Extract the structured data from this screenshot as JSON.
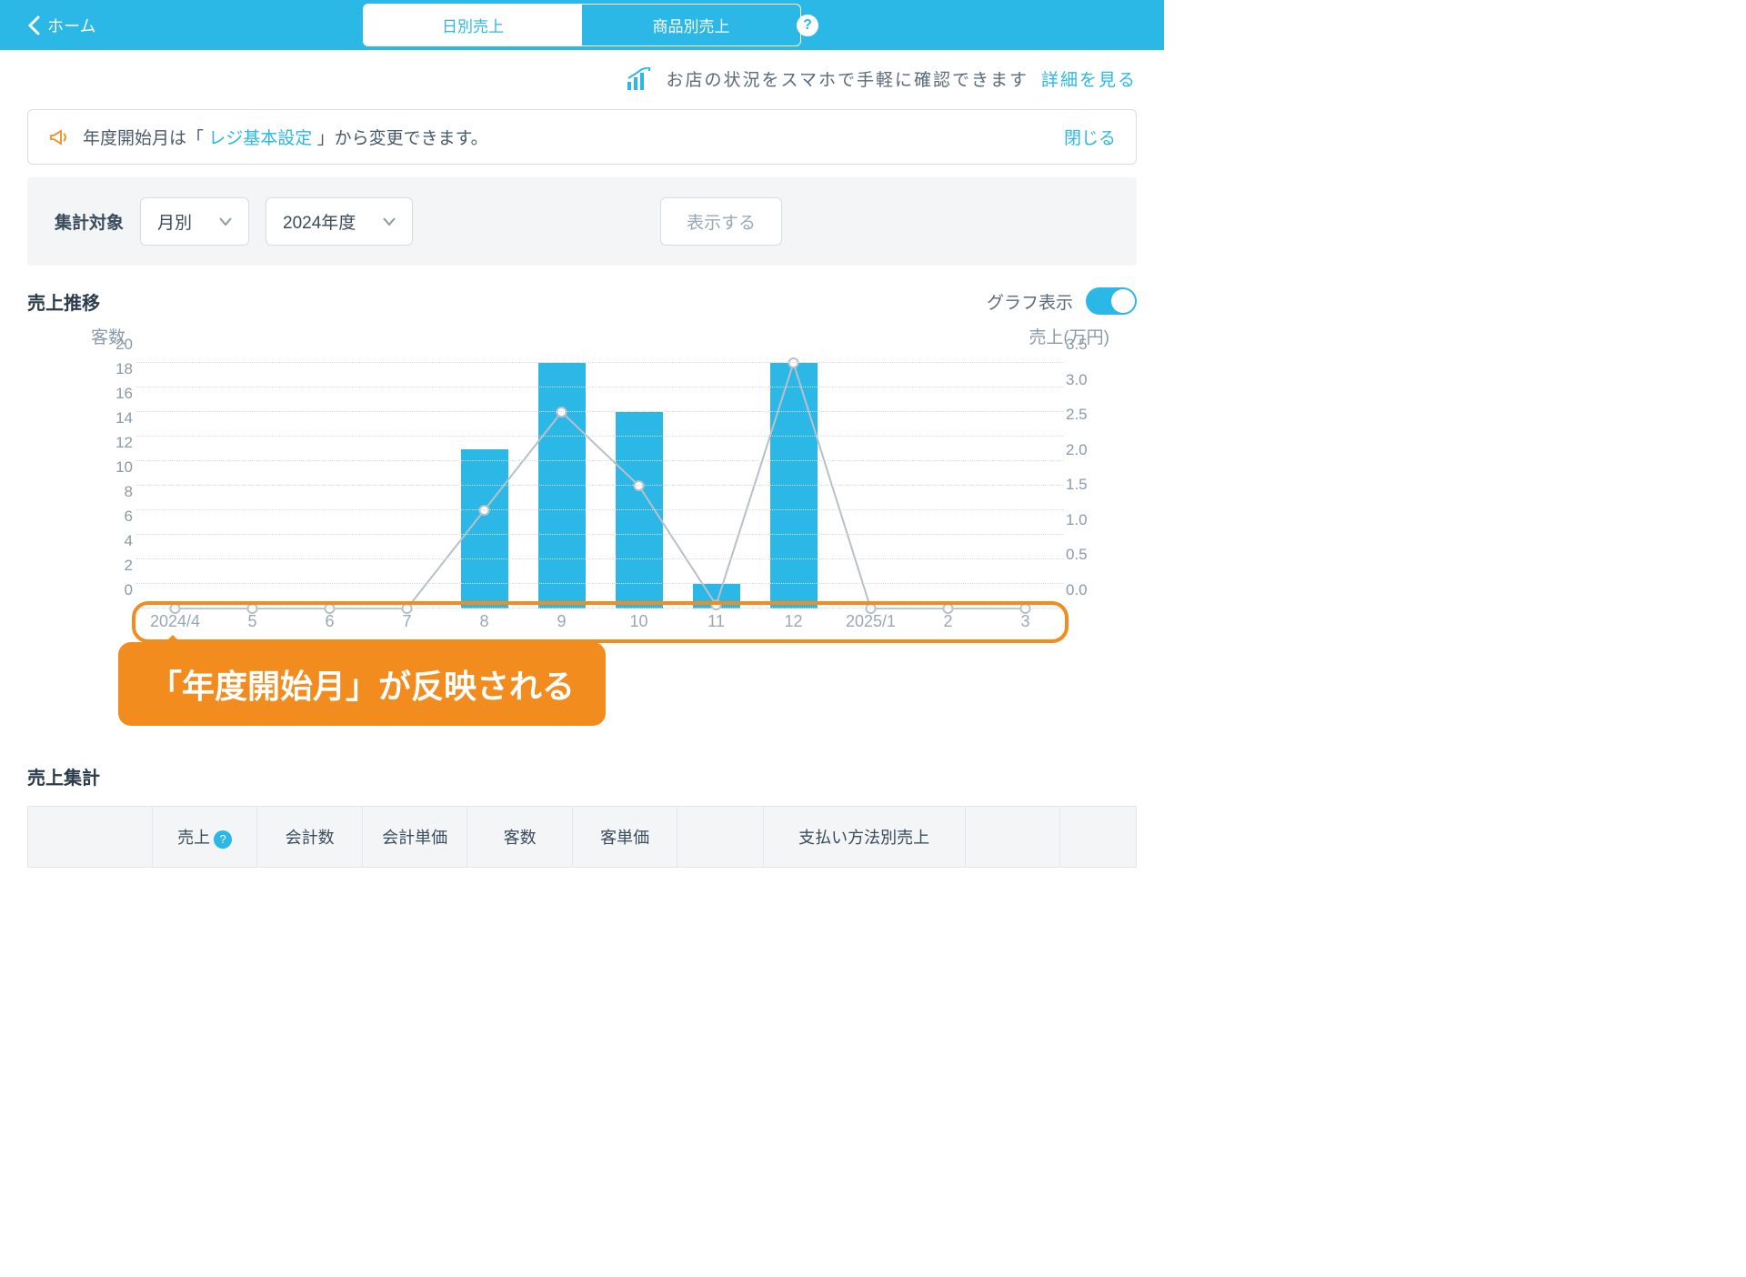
{
  "header": {
    "back": "ホーム",
    "tab_daily": "日別売上",
    "tab_product": "商品別売上"
  },
  "promo": {
    "text": "お店の状況をスマホで手軽に確認できます",
    "link": "詳細を見る"
  },
  "notice": {
    "prefix": "年度開始月は「 ",
    "link": "レジ基本設定",
    "suffix": " 」から変更できます。",
    "close": "閉じる"
  },
  "filter": {
    "label": "集計対象",
    "period": "月別",
    "year": "2024年度",
    "submit": "表示する"
  },
  "trend": {
    "title": "売上推移",
    "toggle_label": "グラフ表示",
    "left_axis": "客数",
    "right_axis": "売上(万円)"
  },
  "callout": "「年度開始月」が反映される",
  "summary": {
    "title": "売上集計"
  },
  "table": {
    "h1": "売上",
    "h2": "会計数",
    "h3": "会計単価",
    "h4": "客数",
    "h5": "客単価",
    "h6": "支払い方法別売上"
  },
  "chart_data": {
    "type": "bar+line",
    "categories": [
      "2024/4",
      "5",
      "6",
      "7",
      "8",
      "9",
      "10",
      "11",
      "12",
      "2025/1",
      "2",
      "3"
    ],
    "left_axis": {
      "label": "客数",
      "ticks": [
        0,
        2,
        4,
        6,
        8,
        10,
        12,
        14,
        16,
        18,
        20
      ],
      "range": [
        0,
        20
      ]
    },
    "right_axis": {
      "label": "売上(万円)",
      "ticks": [
        0.0,
        0.5,
        1.0,
        1.5,
        2.0,
        2.5,
        3.0,
        3.5
      ],
      "range": [
        0,
        3.5
      ]
    },
    "series": [
      {
        "name": "客数",
        "type": "bar",
        "axis": "left",
        "values": [
          0,
          0,
          0,
          0,
          13,
          20,
          16,
          2,
          20,
          0,
          0,
          0
        ]
      },
      {
        "name": "売上(万円)",
        "type": "line",
        "axis": "right",
        "values": [
          0,
          0,
          0,
          0,
          1.4,
          2.8,
          1.75,
          0.05,
          3.5,
          0,
          0,
          0
        ]
      }
    ]
  }
}
